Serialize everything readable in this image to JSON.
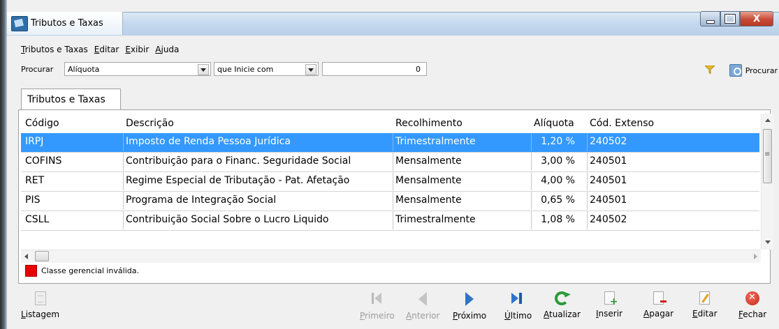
{
  "window": {
    "title": "Tributos e Taxas",
    "controls": {
      "minimize": "—",
      "maximize": "□",
      "close": "X"
    }
  },
  "menu": [
    "Tributos e Taxas",
    "Editar",
    "Exibir",
    "Ajuda"
  ],
  "search": {
    "label": "Procurar",
    "field": "Alíquota",
    "operator": "que Inicie com",
    "value": "0",
    "find_label": "Procurar"
  },
  "tabs": [
    "Tributos e Taxas"
  ],
  "table": {
    "columns": [
      "Código",
      "Descrição",
      "Recolhimento",
      "Alíquota",
      "Cód. Extenso"
    ],
    "rows": [
      {
        "codigo": "IRPJ",
        "descricao": "Imposto de Renda Pessoa Jurídica",
        "recolhimento": "Trimestralmente",
        "aliquota": "1,20 %",
        "extenso": "240502",
        "selected": true
      },
      {
        "codigo": "COFINS",
        "descricao": "Contribuição para o Financ. Seguridade Social",
        "recolhimento": "Mensalmente",
        "aliquota": "3,00 %",
        "extenso": "240501",
        "selected": false
      },
      {
        "codigo": "RET",
        "descricao": "Regime Especial de Tributação - Pat. Afetação",
        "recolhimento": "Mensalmente",
        "aliquota": "4,00 %",
        "extenso": "240501",
        "selected": false
      },
      {
        "codigo": "PIS",
        "descricao": "Programa de Integração Social",
        "recolhimento": "Mensalmente",
        "aliquota": "0,65 %",
        "extenso": "240501",
        "selected": false
      },
      {
        "codigo": "CSLL",
        "descricao": "Contribuição Social Sobre o Lucro Liquido",
        "recolhimento": "Trimestralmente",
        "aliquota": "1,08 %",
        "extenso": "240502",
        "selected": false
      }
    ]
  },
  "legend": {
    "text": "Classe gerencial inválida.",
    "color": "#e80000"
  },
  "toolbar": {
    "listagem": "Listagem",
    "primeiro": "Primeiro",
    "anterior": "Anterior",
    "proximo": "Próximo",
    "ultimo": "Último",
    "atualizar": "Atualizar",
    "inserir": "Inserir",
    "apagar": "Apagar",
    "editar": "Editar",
    "fechar": "Fechar"
  },
  "colors": {
    "selection": "#3399ff",
    "accent_green": "#2c9a37",
    "accent_blue": "#2e74c8",
    "danger": "#c62b1a"
  }
}
